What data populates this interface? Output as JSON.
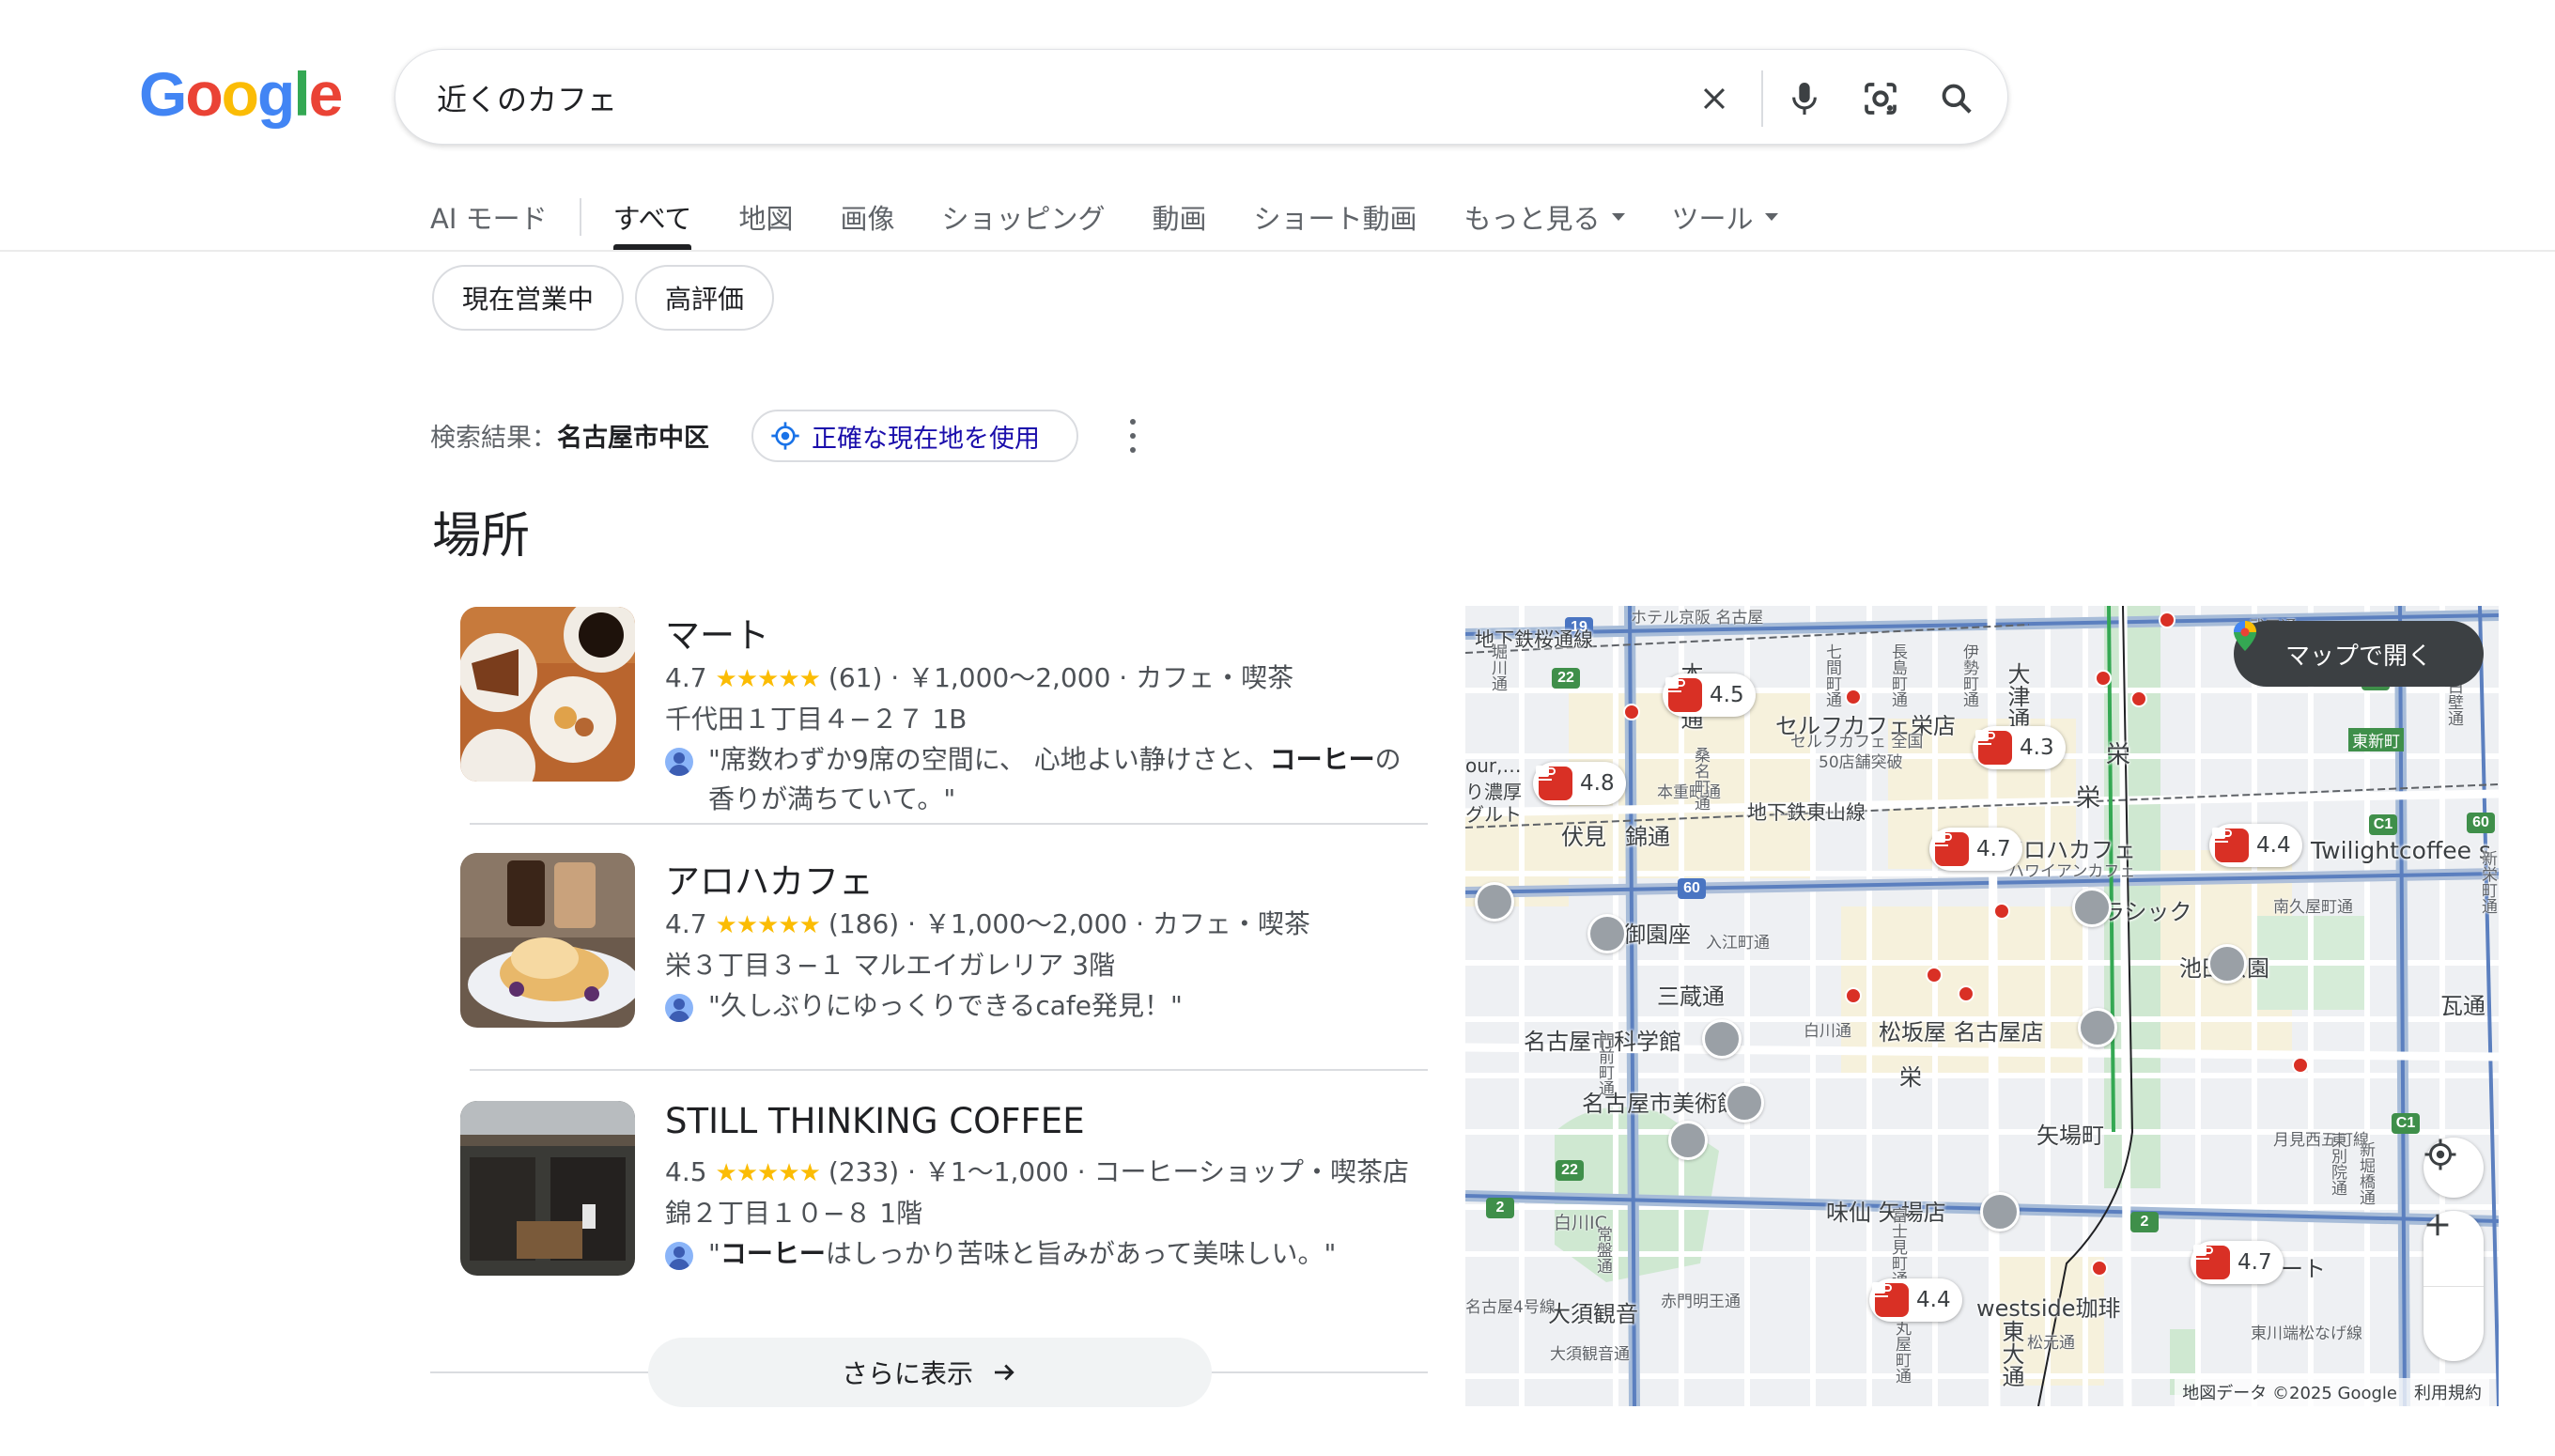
{
  "logo": {
    "letters": [
      "G",
      "o",
      "o",
      "g",
      "l",
      "e"
    ],
    "colors": [
      "#4285F4",
      "#EA4335",
      "#FBBC05",
      "#4285F4",
      "#34A853",
      "#EA4335"
    ]
  },
  "search": {
    "query": "近くのカフェ"
  },
  "tabs": [
    {
      "label": "AI モード"
    },
    {
      "label": "すべて"
    },
    {
      "label": "地図"
    },
    {
      "label": "画像"
    },
    {
      "label": "ショッピング"
    },
    {
      "label": "動画"
    },
    {
      "label": "ショート動画"
    },
    {
      "label": "もっと見る"
    },
    {
      "label": "ツール"
    }
  ],
  "chips": [
    {
      "label": "現在営業中"
    },
    {
      "label": "高評価"
    }
  ],
  "location": {
    "prefix": "検索結果：",
    "area": "名古屋市中区",
    "precise_button": "正確な現在地を使用"
  },
  "section_title": "場所",
  "places": [
    {
      "name": "マート",
      "rating": "4.7",
      "stars": "★★★★★",
      "meta": "(61) · ￥1,000～2,000 · カフェ・喫茶",
      "address": "千代田１丁目４−２７ 1B",
      "review_before": "\"席数わずか9席の空間に、 心地よい静けさと、",
      "review_bold": "コーヒー",
      "review_after": "の香りが満ちていて。\""
    },
    {
      "name": "アロハカフェ",
      "rating": "4.7",
      "stars": "★★★★★",
      "meta": "(186) · ￥1,000～2,000 · カフェ・喫茶",
      "address": "栄３丁目３−１ マルエイガレリア 3階",
      "review_before": "\"久しぶりにゆっくりできるcafe発見！\"",
      "review_bold": "",
      "review_after": ""
    },
    {
      "name": "STILL THINKING COFFEE",
      "rating": "4.5",
      "stars": "★★★★★",
      "meta": "(233) · ￥1～1,000 · コーヒーショップ・喫茶店",
      "address": "錦２丁目１０−８ 1階",
      "review_before": "\"",
      "review_bold": "コーヒー",
      "review_after": "はしっかり苦味と旨みがあって美味しい。\""
    }
  ],
  "more_button": "さらに表示",
  "map": {
    "open_button": "マップで開く",
    "footer": "地図データ ©2025 Google　利用規約",
    "pins": [
      {
        "rating": "4.5"
      },
      {
        "rating": "4.8"
      },
      {
        "rating": "4.3"
      },
      {
        "rating": "4.7"
      },
      {
        "rating": "4.4"
      },
      {
        "rating": "4.7"
      },
      {
        "rating": "4.4"
      }
    ],
    "labels": {
      "pin_self": "セルフカフェ栄店",
      "pin_self_sub1": "セルフカフェ 全国",
      "pin_self_sub2": "50店舗突破",
      "aloha": "アロハカフェ",
      "aloha_sub": "ハワイアンカフェ",
      "twilight": "Twilightcoffee s",
      "mart": "マート",
      "westside": "westside珈琲",
      "sakae_st": "栄",
      "sakae": "栄",
      "fushimi": "伏見",
      "nishiki": "錦通",
      "gosho": "御園座",
      "misono_top": "地下鉄桜通線",
      "higashiyama": "地下鉄東山線",
      "hotel": "ホテル京阪 名古屋",
      "otsu": "大津通",
      "honmachi": "本町通",
      "ikeda": "池田公園",
      "rashikku": "ラシック",
      "matsuzakaya": "松坂屋 名古屋店",
      "sanzo": "三蔵通",
      "kagakukan": "名古屋市科学館",
      "bijutsukan": "名古屋市美術館",
      "yabacho": "矢場町",
      "misen": "味仙 矢場店",
      "shirakawa": "白川IC",
      "osu": "大須観音",
      "kawara": "瓦通",
      "higashi_shinmachi": "東新町",
      "left_cut1": "our,…",
      "left_cut2": "り濃厚",
      "left_cut3": "グルト",
      "iriecho": "入江町通",
      "shichikencho": "七間町通",
      "nagashima": "長島町通",
      "isecho": "伊勢町通",
      "hommachi2": "本重町通",
      "shirakawa_st": "白川通",
      "minami_hisaya": "南久屋町通",
      "tsukimi": "月見西五町線",
      "higashikawa": "東川端松なげ線",
      "matsumoto": "松元通",
      "akamonmyoo": "赤門明王通",
      "osu_kannon_st": "大須観音通",
      "tokiwa": "常盤通",
      "route4": "名古屋4号線",
      "higashi_otsu": "東大通",
      "takeya": "武平通",
      "shinsakaemachi": "新栄町通",
      "kuwana": "桑名町通",
      "shimizu": "東白壁通",
      "horikawa": "堀川通",
      "monzen": "門前町通",
      "higashi_betsuin": "東別院通",
      "shinboribashi": "新堀橋通",
      "fuji": "富士見町通",
      "maruya": "丸屋町通"
    }
  }
}
